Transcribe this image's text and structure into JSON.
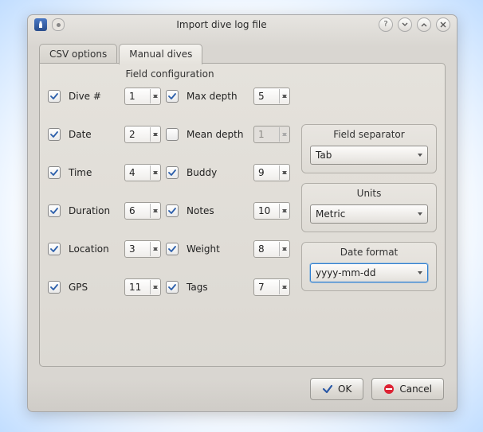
{
  "window": {
    "title": "Import dive log file"
  },
  "tabs": {
    "csv": "CSV options",
    "manual": "Manual dives"
  },
  "section": {
    "title": "Field configuration"
  },
  "left": {
    "dive": {
      "label": "Dive #",
      "value": "1",
      "checked": true
    },
    "date": {
      "label": "Date",
      "value": "2",
      "checked": true
    },
    "time": {
      "label": "Time",
      "value": "4",
      "checked": true
    },
    "duration": {
      "label": "Duration",
      "value": "6",
      "checked": true
    },
    "location": {
      "label": "Location",
      "value": "3",
      "checked": true
    },
    "gps": {
      "label": "GPS",
      "value": "11",
      "checked": true
    }
  },
  "right": {
    "maxdepth": {
      "label": "Max depth",
      "value": "5",
      "checked": true
    },
    "meandepth": {
      "label": "Mean depth",
      "value": "1",
      "checked": false
    },
    "buddy": {
      "label": "Buddy",
      "value": "9",
      "checked": true
    },
    "notes": {
      "label": "Notes",
      "value": "10",
      "checked": true
    },
    "weight": {
      "label": "Weight",
      "value": "8",
      "checked": true
    },
    "tags": {
      "label": "Tags",
      "value": "7",
      "checked": true
    }
  },
  "side": {
    "sep": {
      "title": "Field separator",
      "value": "Tab"
    },
    "units": {
      "title": "Units",
      "value": "Metric"
    },
    "date": {
      "title": "Date format",
      "value": "yyyy-mm-dd"
    }
  },
  "buttons": {
    "ok": "OK",
    "cancel": "Cancel"
  }
}
